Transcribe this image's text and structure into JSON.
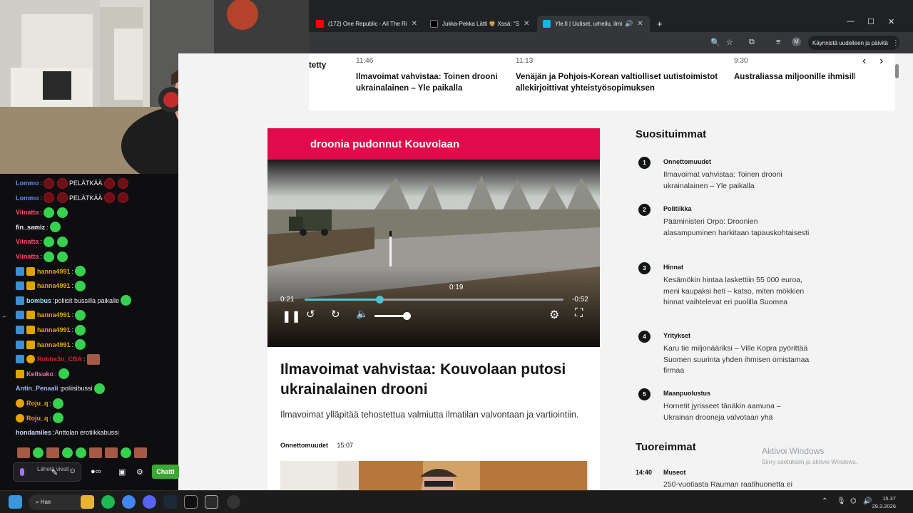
{
  "browser": {
    "tabs": [
      {
        "title": "(172) One Republic - All The Ri",
        "favicon_color": "#ff0000"
      },
      {
        "title": "Jukka-Pekka Lätti 🦁 Xssä: \"S",
        "favicon_color": "#ffffff"
      },
      {
        "title": "Yle.fi | Uutiset, urheilu, ilmi",
        "favicon_color": "#13b5ea"
      }
    ],
    "new_tab": "+",
    "restart_button": "Käynnistä uudelleen ja päivitä",
    "profile_initial": "M"
  },
  "ticker": {
    "items": [
      {
        "time": "",
        "text": "tetty"
      },
      {
        "time": "11:46",
        "text": "Ilmavoimat vahvistaa: Toinen drooni ukrainalainen – Yle paikalla"
      },
      {
        "time": "11:13",
        "text": "Venäjän ja Pohjois-Korean valtiolliset uutistoimistot allekirjoittivat yhteistyösopimuksen"
      },
      {
        "time": "9:30",
        "text": "Australiassa miljoonille ihmisille ilmainen julkinen liikenne"
      }
    ]
  },
  "video": {
    "banner": "droonia pudonnut Kouvolaan",
    "elapsed": "0:21",
    "remaining": "-0:52",
    "hover_time": "0:19",
    "progress": 0.29,
    "volume": 0.9
  },
  "article": {
    "title": "Ilmavoimat vahvistaa: Kouvolaan putosi ukrainalainen drooni",
    "lead": "Ilmavoimat ylläpitää tehostettua valmiutta ilmatilan valvontaan ja vartiointiin.",
    "category": "Onnettomuudet",
    "time": "15:07"
  },
  "popular": {
    "heading": "Suosituimmat",
    "items": [
      {
        "num": "1",
        "cat": "Onnettomuudet",
        "title": "Ilmavoimat vahvistaa: Toinen drooni ukrainalainen – Yle paikalla"
      },
      {
        "num": "2",
        "cat": "Politiikka",
        "title": "Pääministeri Orpo: Droonien alasampuminen harkitaan tapauskohtaisesti"
      },
      {
        "num": "3",
        "cat": "Hinnat",
        "title": "Kesämökin hintaa laskettiin 55 000 euroa, meni kaupaksi heti – katso, miten mökkien hinnat vaihtelevat eri puolilla Suomea"
      },
      {
        "num": "4",
        "cat": "Yritykset",
        "title": "Karu tie miljonääriksi – Ville Kopra pyörittää Suomen suurinta yhden ihmisen omistamaa firmaa"
      },
      {
        "num": "5",
        "cat": "Maanpuolustus",
        "title": "Hornetit jyrisseet tänäkin aamuna – Ukrainan drooneja valvotaan yhä"
      }
    ]
  },
  "latest": {
    "heading": "Tuoreimmat",
    "items": [
      {
        "time": "14:40",
        "cat": "Museot",
        "title": "250-vuotiasta Rauman raatihuonetta ei"
      }
    ]
  },
  "activate_windows": {
    "line1": "Aktivoi Windows",
    "line2": "Siirry asetuksiin ja aktivoi Windows."
  },
  "chat": {
    "messages": [
      {
        "user": "Lommo",
        "color": "#5b8def",
        "text": "PELÄTKÄÄ"
      },
      {
        "user": "Lommo",
        "color": "#5b8def",
        "text": "PELÄTKÄÄ"
      },
      {
        "user": "Viinatta",
        "color": "#ff4d6d",
        "text": ""
      },
      {
        "user": "fin_samiz",
        "color": "#efeff1",
        "text": ""
      },
      {
        "user": "Viinatta",
        "color": "#ff4d6d",
        "text": ""
      },
      {
        "user": "Viinatta",
        "color": "#ff4d6d",
        "text": ""
      },
      {
        "user": "hanna4991",
        "color": "#e0a400",
        "text": ""
      },
      {
        "user": "hanna4991",
        "color": "#e0a400",
        "text": ""
      },
      {
        "user": "bombus",
        "color": "#9be3f7",
        "text": "poliisit bussilla paikalle"
      },
      {
        "user": "hanna4991",
        "color": "#e0a400",
        "text": ""
      },
      {
        "user": "hanna4991",
        "color": "#e0a400",
        "text": ""
      },
      {
        "user": "hanna4991",
        "color": "#e0a400",
        "text": ""
      },
      {
        "user": "Robbs3n_CBA",
        "color": "#d4232b",
        "text": ""
      },
      {
        "user": "Keltsuko",
        "color": "#ff6fa8",
        "text": ""
      },
      {
        "user": "Antin_Penaali",
        "color": "#9bb6f2",
        "text": "poliisibussi"
      },
      {
        "user": "Roju_q",
        "color": "#e0a400",
        "text": ""
      },
      {
        "user": "Roju_q",
        "color": "#e0a400",
        "text": ""
      },
      {
        "user": "hondamiles",
        "color": "#cfd8ff",
        "text": "Anttolan erotiikkabussi"
      }
    ],
    "input_placeholder": "Lähetä viesti",
    "send_button": "Chatti"
  },
  "taskbar": {
    "search": "Hae",
    "time": "15.37",
    "date": "29.3.2026"
  }
}
